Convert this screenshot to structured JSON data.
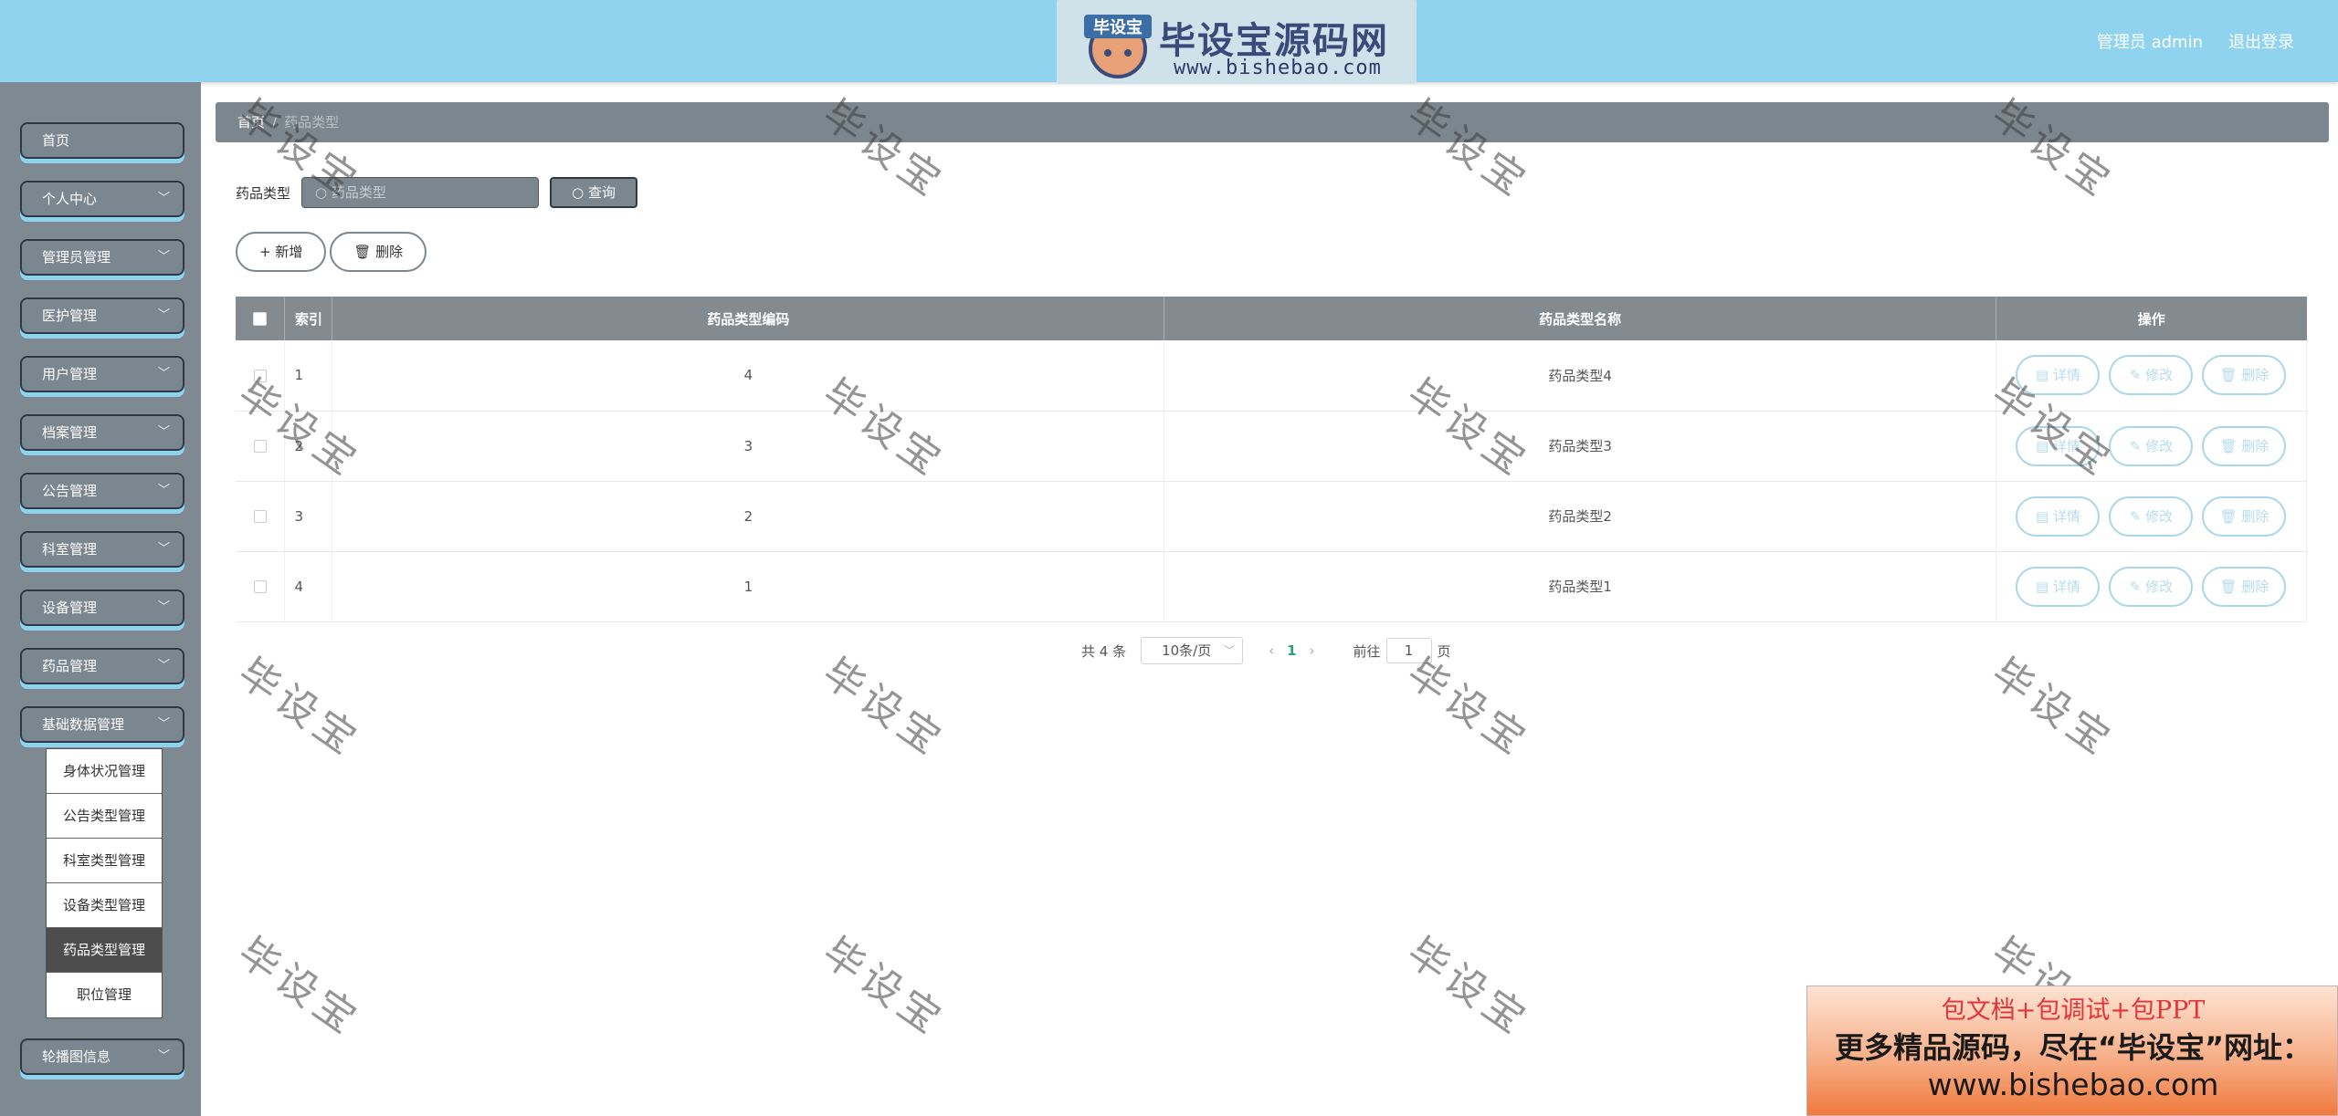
{
  "header": {
    "logo_title": "毕设宝源码网",
    "logo_url": "www.bishebao.com",
    "logo_badge_text": "毕设宝",
    "user_label": "管理员 admin",
    "logout_label": "退出登录"
  },
  "sidebar": {
    "items": [
      {
        "label": "首页"
      },
      {
        "label": "个人中心"
      },
      {
        "label": "管理员管理"
      },
      {
        "label": "医护管理"
      },
      {
        "label": "用户管理"
      },
      {
        "label": "档案管理"
      },
      {
        "label": "公告管理"
      },
      {
        "label": "科室管理"
      },
      {
        "label": "设备管理"
      },
      {
        "label": "药品管理"
      },
      {
        "label": "基础数据管理"
      },
      {
        "label": "轮播图信息"
      }
    ],
    "submenu": [
      {
        "label": "身体状况管理"
      },
      {
        "label": "公告类型管理"
      },
      {
        "label": "科室类型管理"
      },
      {
        "label": "设备类型管理"
      },
      {
        "label": "药品类型管理"
      },
      {
        "label": "职位管理"
      }
    ]
  },
  "breadcrumb": {
    "home": "首页",
    "sep": "/",
    "current": "药品类型"
  },
  "search": {
    "label": "药品类型",
    "placeholder": "药品类型",
    "button": "查询"
  },
  "actions": {
    "add": "新增",
    "delete": "删除"
  },
  "table": {
    "headers": {
      "index": "索引",
      "code": "药品类型编码",
      "name": "药品类型名称",
      "ops": "操作"
    },
    "ops": {
      "detail": "详情",
      "edit": "修改",
      "delete": "删除"
    },
    "rows": [
      {
        "index": "1",
        "code": "4",
        "name": "药品类型4"
      },
      {
        "index": "2",
        "code": "3",
        "name": "药品类型3"
      },
      {
        "index": "3",
        "code": "2",
        "name": "药品类型2"
      },
      {
        "index": "4",
        "code": "1",
        "name": "药品类型1"
      }
    ]
  },
  "pagination": {
    "total": "共 4 条",
    "page_size": "10条/页",
    "current": "1",
    "goto_label": "前往",
    "goto_value": "1",
    "page_unit": "页"
  },
  "watermark": "毕设宝",
  "ad": {
    "line1": "包文档+包调试+包PPT",
    "line2": "更多精品源码，尽在“毕设宝”网址：",
    "line3": "www.bishebao.com"
  },
  "icons": {
    "search": "search-icon",
    "chevron": "chevron-down-icon",
    "plus": "plus-icon",
    "trash": "trash-icon",
    "detail": "document-icon",
    "edit": "pencil-icon"
  }
}
